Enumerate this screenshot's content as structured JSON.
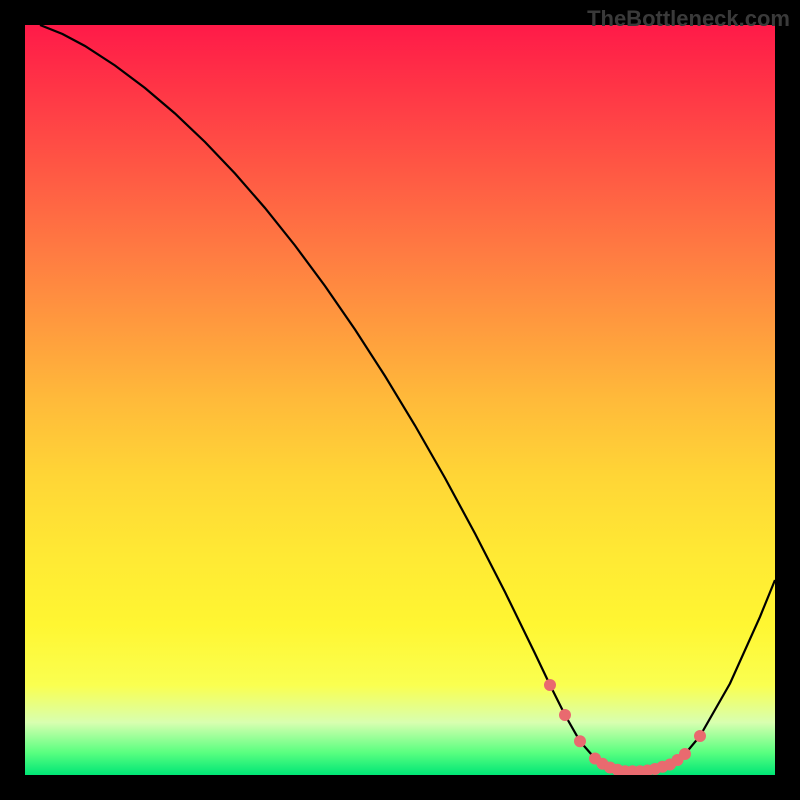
{
  "watermark": "TheBottleneck.com",
  "chart_data": {
    "type": "line",
    "title": "",
    "xlabel": "",
    "ylabel": "",
    "xlim": [
      0,
      100
    ],
    "ylim": [
      0,
      100
    ],
    "series": [
      {
        "name": "curve",
        "x": [
          2,
          5,
          8,
          12,
          16,
          20,
          24,
          28,
          32,
          36,
          40,
          44,
          48,
          52,
          56,
          60,
          64,
          68,
          70,
          72,
          74,
          76,
          78,
          80,
          82,
          84,
          86,
          88,
          90,
          94,
          98,
          100
        ],
        "y": [
          100,
          98.8,
          97.2,
          94.6,
          91.6,
          88.2,
          84.4,
          80.2,
          75.6,
          70.6,
          65.2,
          59.4,
          53.2,
          46.6,
          39.6,
          32.2,
          24.4,
          16.2,
          12,
          8,
          4.5,
          2.2,
          1.0,
          0.5,
          0.5,
          0.8,
          1.4,
          2.8,
          5.2,
          12.2,
          21.1,
          26
        ]
      }
    ],
    "marker_points": {
      "x": [
        70,
        72,
        74,
        76,
        77,
        78,
        79,
        80,
        81,
        82,
        83,
        84,
        85,
        86,
        87,
        88,
        90
      ],
      "y": [
        12,
        8,
        4.5,
        2.2,
        1.5,
        1.0,
        0.7,
        0.5,
        0.5,
        0.5,
        0.6,
        0.8,
        1.1,
        1.4,
        2.0,
        2.8,
        5.2
      ]
    }
  }
}
